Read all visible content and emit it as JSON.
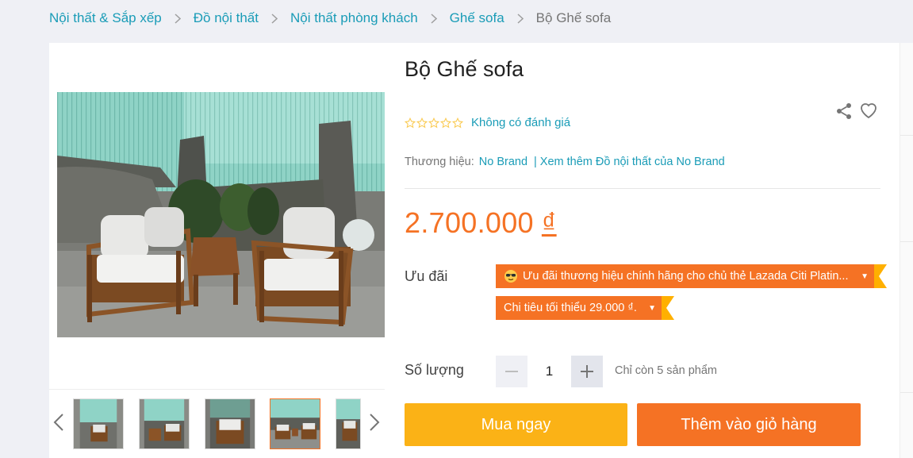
{
  "breadcrumb": {
    "items": [
      "Nội thất & Sắp xếp",
      "Đồ nội thất",
      "Nội thất phòng khách",
      "Ghế sofa"
    ],
    "current": "Bộ Ghế sofa"
  },
  "product": {
    "title": "Bộ Ghế sofa",
    "rating_text": "Không có đánh giá",
    "stars": 0,
    "brand_label": "Thương hiệu:",
    "brand": "No Brand",
    "brand_more": "Xem thêm Đồ nội thất của No Brand",
    "price": "2.700.000",
    "currency": "₫"
  },
  "promotions": {
    "label": "Ưu đãi",
    "vouchers": [
      "Ưu đãi thương hiệu chính hãng cho chủ thẻ Lazada Citi Platin...",
      "Chi tiêu tối thiểu 29.000 ₫."
    ]
  },
  "quantity": {
    "label": "Số lượng",
    "value": "1",
    "stock": "Chỉ còn 5 sản phẩm"
  },
  "actions": {
    "buy_now": "Mua ngay",
    "add_to_cart": "Thêm vào giỏ hàng"
  },
  "gallery": {
    "thumb_count": 5,
    "active_index": 3
  },
  "colors": {
    "accent_orange": "#f57224",
    "buy_yellow": "#fbb216",
    "link_blue": "#1a9cb7"
  },
  "icons": [
    "chevron-right-icon",
    "share-icon",
    "heart-icon",
    "star-outline-icon",
    "minus-icon",
    "plus-icon",
    "chevron-left-icon",
    "caret-down-icon"
  ]
}
